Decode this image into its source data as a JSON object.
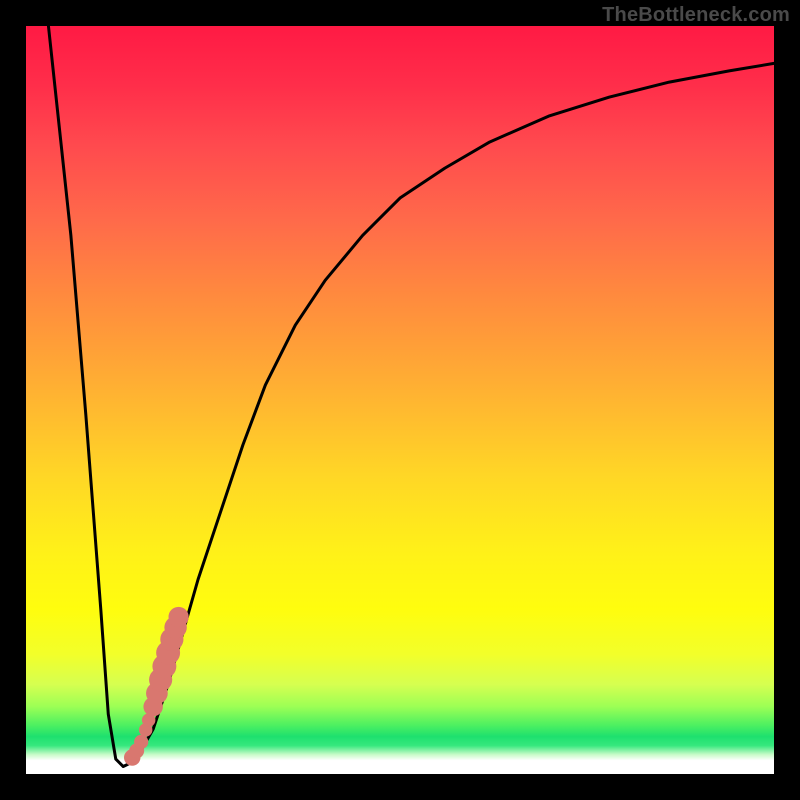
{
  "watermark": "TheBottleneck.com",
  "colors": {
    "frame": "#000000",
    "curve": "#000000",
    "dots": "#d9776f"
  },
  "chart_data": {
    "type": "line",
    "title": "",
    "xlabel": "",
    "ylabel": "",
    "xlim": [
      0,
      100
    ],
    "ylim": [
      0,
      100
    ],
    "grid": false,
    "legend": false,
    "series": [
      {
        "name": "bottleneck-curve",
        "x": [
          3,
          6,
          8,
          10,
          11,
          12,
          13,
          14,
          15,
          17,
          19,
          21,
          23,
          26,
          29,
          32,
          36,
          40,
          45,
          50,
          56,
          62,
          70,
          78,
          86,
          94,
          100
        ],
        "y": [
          100,
          72,
          48,
          22,
          8,
          2,
          1,
          1.5,
          2.5,
          6,
          12,
          19,
          26,
          35,
          44,
          52,
          60,
          66,
          72,
          77,
          81,
          84.5,
          88,
          90.5,
          92.5,
          94,
          95
        ]
      }
    ],
    "dot_cluster": {
      "name": "highlighted-points",
      "color": "#d9776f",
      "points": [
        {
          "x": 14.2,
          "y": 2.2,
          "r": 1.1
        },
        {
          "x": 14.8,
          "y": 3.1,
          "r": 1.0
        },
        {
          "x": 15.4,
          "y": 4.3,
          "r": 0.95
        },
        {
          "x": 16.0,
          "y": 5.9,
          "r": 0.9
        },
        {
          "x": 16.4,
          "y": 7.2,
          "r": 0.9
        },
        {
          "x": 17.0,
          "y": 9.0,
          "r": 1.3
        },
        {
          "x": 17.5,
          "y": 10.8,
          "r": 1.45
        },
        {
          "x": 18.0,
          "y": 12.6,
          "r": 1.55
        },
        {
          "x": 18.5,
          "y": 14.4,
          "r": 1.6
        },
        {
          "x": 19.0,
          "y": 16.2,
          "r": 1.6
        },
        {
          "x": 19.5,
          "y": 18.0,
          "r": 1.55
        },
        {
          "x": 20.0,
          "y": 19.6,
          "r": 1.5
        },
        {
          "x": 20.4,
          "y": 21.0,
          "r": 1.35
        }
      ]
    }
  }
}
